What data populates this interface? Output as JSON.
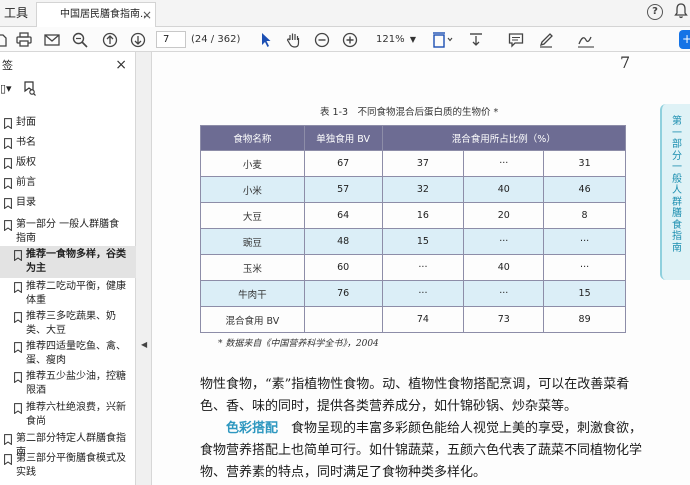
{
  "tabbar": {
    "tools_label": "工具",
    "tab_title": "中国居民膳食指南...",
    "tab_close": "×",
    "help": "?"
  },
  "toolbar": {
    "page_value": "7",
    "page_count": "(24 / 362)",
    "zoom": "121%"
  },
  "bookmarks": {
    "header": "签",
    "close": "×",
    "items": [
      {
        "label": "封面"
      },
      {
        "label": "书名"
      },
      {
        "label": "版权"
      },
      {
        "label": "前言"
      },
      {
        "label": "目录"
      },
      {
        "label": "第一部分 一般人群膳食指南"
      },
      {
        "label": "推荐一食物多样，谷类为主"
      },
      {
        "label": "推荐二吃动平衡，健康体重"
      },
      {
        "label": "推荐三多吃蔬果、奶类、大豆"
      },
      {
        "label": "推荐四适量吃鱼、禽、蛋、瘦肉"
      },
      {
        "label": "推荐五少盐少油，控糖限酒"
      },
      {
        "label": "推荐六杜绝浪费，兴新食尚"
      },
      {
        "label": "第二部分特定人群膳食指南"
      },
      {
        "label": "第三部分平衡膳食模式及实践"
      }
    ]
  },
  "document": {
    "page_number": "7",
    "side_tab": "第一部分 一般人群膳食指南",
    "table_title": "表 1-3　不同食物混合后蛋白质的生物价 *",
    "table": {
      "headers": [
        "食物名称",
        "单独食用 BV",
        "混合食用所占比例（%）"
      ],
      "rows": [
        [
          "小麦",
          "67",
          "37",
          "···",
          "31"
        ],
        [
          "小米",
          "57",
          "32",
          "40",
          "46"
        ],
        [
          "大豆",
          "64",
          "16",
          "20",
          "8"
        ],
        [
          "豌豆",
          "48",
          "15",
          "···",
          "···"
        ],
        [
          "玉米",
          "60",
          "···",
          "40",
          "···"
        ],
        [
          "牛肉干",
          "76",
          "···",
          "···",
          "15"
        ],
        [
          "混合食用 BV",
          "",
          "74",
          "73",
          "89"
        ]
      ]
    },
    "footnote": "* 数据来自《中国营养科学全书》，2004",
    "para1": "物性食物，“素”指植物性食物。动、植物性食物搭配烹调，可以在改善菜肴色、香、味的同时，提供各类营养成分，如什锦砂锅、炒杂菜等。",
    "para2_keyword": "色彩搭配",
    "para2": "　食物呈现的丰富多彩颜色能给人视觉上美的享受，刺激食欲，食物营养搭配上也简单可行。如什锦蔬菜，五颜六色代表了蔬菜不同植物化学物、营养素的特点，同时满足了食物种类多样化。"
  }
}
